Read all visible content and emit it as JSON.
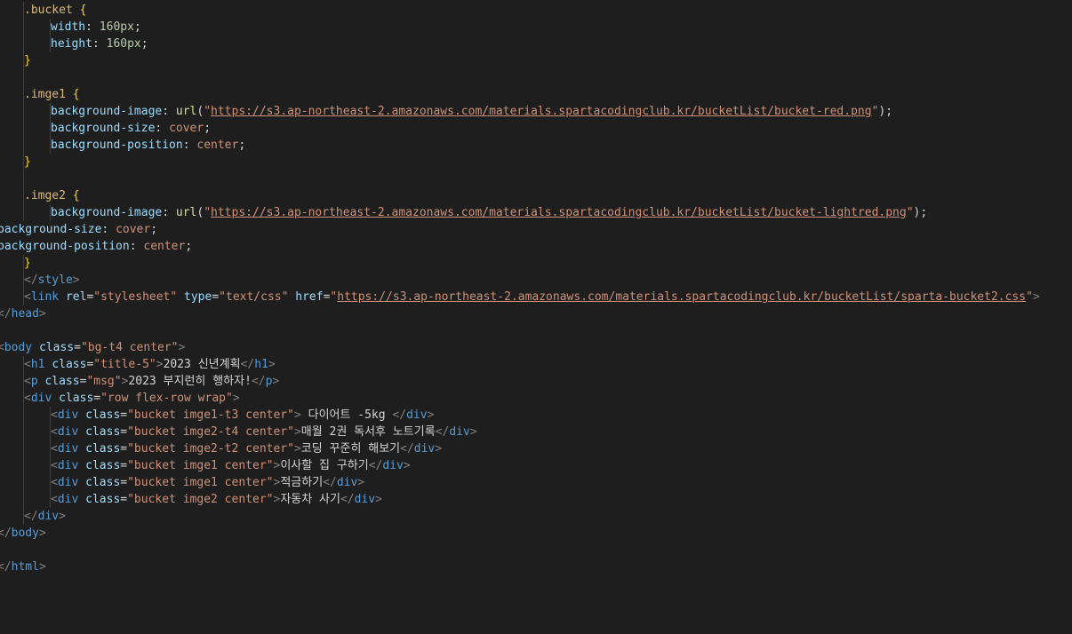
{
  "editor": {
    "colors": {
      "background": "#1e1e1e",
      "selector": "#d7ba7d",
      "brace": "#ffd700",
      "property": "#9cdcfe",
      "number": "#b5cea8",
      "string": "#ce9178",
      "function": "#dcdcaa",
      "tag": "#569cd6",
      "tag_bracket": "#808080",
      "text": "#d4d4d4"
    },
    "lines": [
      {
        "indent": 1,
        "tokens": [
          [
            "sel",
            ".bucket"
          ],
          [
            "punct",
            " "
          ],
          [
            "brace",
            "{"
          ]
        ]
      },
      {
        "indent": 2,
        "tokens": [
          [
            "prop",
            "width"
          ],
          [
            "punct",
            ": "
          ],
          [
            "num",
            "160px"
          ],
          [
            "punct",
            ";"
          ]
        ]
      },
      {
        "indent": 2,
        "tokens": [
          [
            "prop",
            "height"
          ],
          [
            "punct",
            ": "
          ],
          [
            "num",
            "160px"
          ],
          [
            "punct",
            ";"
          ]
        ]
      },
      {
        "indent": 1,
        "tokens": [
          [
            "brace",
            "}"
          ]
        ]
      },
      {
        "indent": 1,
        "tokens": []
      },
      {
        "indent": 1,
        "tokens": [
          [
            "sel",
            ".imge1"
          ],
          [
            "punct",
            " "
          ],
          [
            "brace",
            "{"
          ]
        ]
      },
      {
        "indent": 2,
        "tokens": [
          [
            "prop",
            "background-image"
          ],
          [
            "punct",
            ": "
          ],
          [
            "fn",
            "url"
          ],
          [
            "punct",
            "("
          ],
          [
            "str",
            "\""
          ],
          [
            "link",
            "https://s3.ap-northeast-2.amazonaws.com/materials.spartacodingclub.kr/bucketList/bucket-red.png"
          ],
          [
            "str",
            "\""
          ],
          [
            "punct",
            ");"
          ]
        ]
      },
      {
        "indent": 2,
        "tokens": [
          [
            "prop",
            "background-size"
          ],
          [
            "punct",
            ": "
          ],
          [
            "str",
            "cover"
          ],
          [
            "punct",
            ";"
          ]
        ]
      },
      {
        "indent": 2,
        "tokens": [
          [
            "prop",
            "background-position"
          ],
          [
            "punct",
            ": "
          ],
          [
            "str",
            "center"
          ],
          [
            "punct",
            ";"
          ]
        ]
      },
      {
        "indent": 1,
        "tokens": [
          [
            "brace",
            "}"
          ]
        ]
      },
      {
        "indent": 1,
        "tokens": []
      },
      {
        "indent": 1,
        "tokens": [
          [
            "sel",
            ".imge2"
          ],
          [
            "punct",
            " "
          ],
          [
            "brace",
            "{"
          ]
        ]
      },
      {
        "indent": 2,
        "tokens": [
          [
            "prop",
            "background-image"
          ],
          [
            "punct",
            ": "
          ],
          [
            "fn",
            "url"
          ],
          [
            "punct",
            "("
          ],
          [
            "str",
            "\""
          ],
          [
            "link",
            "https://s3.ap-northeast-2.amazonaws.com/materials.spartacodingclub.kr/bucketList/bucket-lightred.png"
          ],
          [
            "str",
            "\""
          ],
          [
            "punct",
            ");"
          ]
        ]
      },
      {
        "indent": 0,
        "tokens": [
          [
            "prop",
            "background-size"
          ],
          [
            "punct",
            ": "
          ],
          [
            "str",
            "cover"
          ],
          [
            "punct",
            ";"
          ]
        ]
      },
      {
        "indent": 0,
        "tokens": [
          [
            "prop",
            "background-position"
          ],
          [
            "punct",
            ": "
          ],
          [
            "str",
            "center"
          ],
          [
            "punct",
            ";"
          ]
        ]
      },
      {
        "indent": 1,
        "tokens": [
          [
            "brace",
            "}"
          ]
        ]
      },
      {
        "indent": 1,
        "tokens": [
          [
            "br",
            "</"
          ],
          [
            "tag",
            "style"
          ],
          [
            "br",
            ">"
          ]
        ]
      },
      {
        "indent": 1,
        "tokens": [
          [
            "br",
            "<"
          ],
          [
            "tag",
            "link"
          ],
          [
            "punct",
            " "
          ],
          [
            "attr",
            "rel"
          ],
          [
            "punct",
            "="
          ],
          [
            "str",
            "\"stylesheet\""
          ],
          [
            "punct",
            " "
          ],
          [
            "attr",
            "type"
          ],
          [
            "punct",
            "="
          ],
          [
            "str",
            "\"text/css\""
          ],
          [
            "punct",
            " "
          ],
          [
            "attr",
            "href"
          ],
          [
            "punct",
            "="
          ],
          [
            "str",
            "\""
          ],
          [
            "link",
            "https://s3.ap-northeast-2.amazonaws.com/materials.spartacodingclub.kr/bucketList/sparta-bucket2.css"
          ],
          [
            "str",
            "\""
          ],
          [
            "br",
            ">"
          ]
        ]
      },
      {
        "indent": 0,
        "tokens": [
          [
            "br",
            "</"
          ],
          [
            "tag",
            "head"
          ],
          [
            "br",
            ">"
          ]
        ]
      },
      {
        "indent": 0,
        "tokens": []
      },
      {
        "indent": 0,
        "tokens": [
          [
            "br",
            "<"
          ],
          [
            "tag",
            "body"
          ],
          [
            "punct",
            " "
          ],
          [
            "attr",
            "class"
          ],
          [
            "punct",
            "="
          ],
          [
            "str",
            "\"bg-t4 center\""
          ],
          [
            "br",
            ">"
          ]
        ]
      },
      {
        "indent": 1,
        "tokens": [
          [
            "br",
            "<"
          ],
          [
            "tag",
            "h1"
          ],
          [
            "punct",
            " "
          ],
          [
            "attr",
            "class"
          ],
          [
            "punct",
            "="
          ],
          [
            "str",
            "\"title-5\""
          ],
          [
            "br",
            ">"
          ],
          [
            "txt",
            "2023 신년계획"
          ],
          [
            "br",
            "</"
          ],
          [
            "tag",
            "h1"
          ],
          [
            "br",
            ">"
          ]
        ]
      },
      {
        "indent": 1,
        "tokens": [
          [
            "br",
            "<"
          ],
          [
            "tag",
            "p"
          ],
          [
            "punct",
            " "
          ],
          [
            "attr",
            "class"
          ],
          [
            "punct",
            "="
          ],
          [
            "str",
            "\"msg\""
          ],
          [
            "br",
            ">"
          ],
          [
            "txt",
            "2023 부지런히 행하자!"
          ],
          [
            "br",
            "</"
          ],
          [
            "tag",
            "p"
          ],
          [
            "br",
            ">"
          ]
        ]
      },
      {
        "indent": 1,
        "tokens": [
          [
            "br",
            "<"
          ],
          [
            "tag",
            "div"
          ],
          [
            "punct",
            " "
          ],
          [
            "attr",
            "class"
          ],
          [
            "punct",
            "="
          ],
          [
            "str",
            "\"row flex-row wrap\""
          ],
          [
            "br",
            ">"
          ]
        ]
      },
      {
        "indent": 2,
        "tokens": [
          [
            "br",
            "<"
          ],
          [
            "tag",
            "div"
          ],
          [
            "punct",
            " "
          ],
          [
            "attr",
            "class"
          ],
          [
            "punct",
            "="
          ],
          [
            "str",
            "\"bucket imge1-t3 center\""
          ],
          [
            "br",
            ">"
          ],
          [
            "txt",
            " 다이어트 -5kg "
          ],
          [
            "br",
            "</"
          ],
          [
            "tag",
            "div"
          ],
          [
            "br",
            ">"
          ]
        ]
      },
      {
        "indent": 2,
        "tokens": [
          [
            "br",
            "<"
          ],
          [
            "tag",
            "div"
          ],
          [
            "punct",
            " "
          ],
          [
            "attr",
            "class"
          ],
          [
            "punct",
            "="
          ],
          [
            "str",
            "\"bucket imge2-t4 center\""
          ],
          [
            "br",
            ">"
          ],
          [
            "txt",
            "매월 2권 독서후 노트기록"
          ],
          [
            "br",
            "</"
          ],
          [
            "tag",
            "div"
          ],
          [
            "br",
            ">"
          ]
        ]
      },
      {
        "indent": 2,
        "tokens": [
          [
            "br",
            "<"
          ],
          [
            "tag",
            "div"
          ],
          [
            "punct",
            " "
          ],
          [
            "attr",
            "class"
          ],
          [
            "punct",
            "="
          ],
          [
            "str",
            "\"bucket imge2-t2 center\""
          ],
          [
            "br",
            ">"
          ],
          [
            "txt",
            "코딩 꾸준히 해보기"
          ],
          [
            "br",
            "</"
          ],
          [
            "tag",
            "div"
          ],
          [
            "br",
            ">"
          ]
        ]
      },
      {
        "indent": 2,
        "tokens": [
          [
            "br",
            "<"
          ],
          [
            "tag",
            "div"
          ],
          [
            "punct",
            " "
          ],
          [
            "attr",
            "class"
          ],
          [
            "punct",
            "="
          ],
          [
            "str",
            "\"bucket imge1 center\""
          ],
          [
            "br",
            ">"
          ],
          [
            "txt",
            "이사할 집 구하기"
          ],
          [
            "br",
            "</"
          ],
          [
            "tag",
            "div"
          ],
          [
            "br",
            ">"
          ]
        ]
      },
      {
        "indent": 2,
        "tokens": [
          [
            "br",
            "<"
          ],
          [
            "tag",
            "div"
          ],
          [
            "punct",
            " "
          ],
          [
            "attr",
            "class"
          ],
          [
            "punct",
            "="
          ],
          [
            "str",
            "\"bucket imge1 center\""
          ],
          [
            "br",
            ">"
          ],
          [
            "txt",
            "적금하기"
          ],
          [
            "br",
            "</"
          ],
          [
            "tag",
            "div"
          ],
          [
            "br",
            ">"
          ]
        ]
      },
      {
        "indent": 2,
        "tokens": [
          [
            "br",
            "<"
          ],
          [
            "tag",
            "div"
          ],
          [
            "punct",
            " "
          ],
          [
            "attr",
            "class"
          ],
          [
            "punct",
            "="
          ],
          [
            "str",
            "\"bucket imge2 center\""
          ],
          [
            "br",
            ">"
          ],
          [
            "txt",
            "자동차 사기"
          ],
          [
            "br",
            "</"
          ],
          [
            "tag",
            "div"
          ],
          [
            "br",
            ">"
          ]
        ]
      },
      {
        "indent": 1,
        "tokens": [
          [
            "br",
            "</"
          ],
          [
            "tag",
            "div"
          ],
          [
            "br",
            ">"
          ]
        ]
      },
      {
        "indent": 0,
        "tokens": [
          [
            "br",
            "</"
          ],
          [
            "tag",
            "body"
          ],
          [
            "br",
            ">"
          ]
        ]
      },
      {
        "indent": 0,
        "tokens": []
      },
      {
        "indent": 0,
        "tokens": [
          [
            "br",
            "</"
          ],
          [
            "tag",
            "html"
          ],
          [
            "br",
            ">"
          ]
        ]
      }
    ]
  }
}
